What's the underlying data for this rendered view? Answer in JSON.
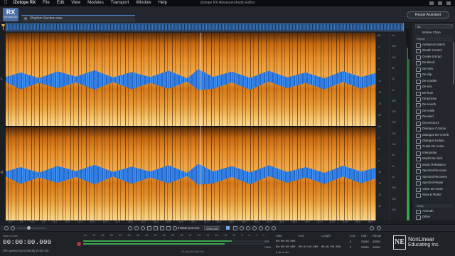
{
  "menubar": {
    "app_name": "iZotope RX",
    "items": [
      "File",
      "Edit",
      "View",
      "Modules",
      "Transport",
      "Window",
      "Help"
    ]
  },
  "window_title": "iZotope RX Advanced Audio Editor",
  "header": {
    "logo": "RX",
    "logo_sub": "ADVANCED",
    "file_tab": "Rhythm Section.wav",
    "repair_assistant": "Repair Assistant"
  },
  "panel": {
    "filter_value": "All",
    "module_chain": "Module Chain",
    "repair_header": "Repair",
    "modules": [
      "Ambience Match",
      "Breath Control",
      "Center Extract",
      "De-bleed",
      "De-click",
      "De-clip",
      "De-crackle",
      "De-ess",
      "De-hum",
      "De-plosive",
      "De-reverb",
      "De-rustle",
      "De-wind",
      "Deconstruct",
      "Dialogue Contour",
      "Dialogue De-reverb",
      "Dialogue Isolate",
      "Guitar De-noise",
      "Interpolate",
      "Mouth De-click",
      "Music Rebalance",
      "Spectral De-noise",
      "Spectral Recovery",
      "Spectral Repair",
      "Voice De-noise",
      "Wow & Flutter"
    ],
    "utility_header": "Utility",
    "utility_modules": [
      "Azimuth",
      "Dither"
    ]
  },
  "channel_labels": [
    "L",
    "R"
  ],
  "db_ticks": [
    "dB",
    "-3",
    "-6",
    "-9",
    "-12",
    "-15",
    "-20",
    "-30",
    "-inf",
    "-3",
    "-6",
    "-9",
    "-12",
    "-15",
    "-20",
    "-30"
  ],
  "hz_ticks": [
    "Hz",
    "20k",
    "10k",
    "5k",
    "2k",
    "1k",
    "500",
    "200",
    "100",
    "20k",
    "10k",
    "5k",
    "2k",
    "1k",
    "500",
    "200",
    "100"
  ],
  "ruler_ticks": [
    "0.0",
    "2.0",
    "4.0",
    "6.0",
    "8.0",
    "10.0",
    "12.0",
    "14.0",
    "16.0",
    "18.0",
    "20.0",
    "22.0",
    "24.0",
    "26.0",
    "28.0",
    "30.0",
    "32.0",
    "34.0",
    "36.0",
    "38.0",
    "40.0",
    "42.0",
    "44.0",
    "46.0",
    "48.0",
    "50.0",
    "52.0",
    "54.0",
    "56.0",
    "58.0"
  ],
  "toolbar": {
    "instant_process": "Instant process",
    "mode": "Attenuate"
  },
  "transport": {
    "label": "Sub.Lvl.sec",
    "time": "00:00:00.000",
    "status": "File opened successfully (0.00 ms)",
    "meter_scale": [
      "-inf",
      "-70",
      "-60",
      "-54",
      "-50",
      "-48",
      "-45",
      "-42",
      "-39",
      "-36",
      "-33",
      "-30",
      "-27",
      "-24",
      "-21",
      "-18",
      "-15",
      "-12",
      "-9",
      "-6",
      "-3",
      "0"
    ],
    "level_left": 0.82,
    "level_right": 0.78,
    "format": "24-bit | 48,000 Hz"
  },
  "selection": {
    "headers": [
      "Start",
      "End",
      "Length"
    ],
    "rows": [
      {
        "label": "Sel",
        "start": "00:00:00.000",
        "end": "",
        "length": ""
      },
      {
        "label": "View",
        "start": "00:00:00.000",
        "end": "00:01:00.000",
        "length": "00:01:00.000"
      }
    ],
    "format_label": "h:m:s.ms"
  },
  "range": {
    "headers": [
      "Low",
      "High",
      "Range"
    ],
    "rows": [
      {
        "low": "0",
        "high": "22050",
        "range": "22050"
      },
      {
        "low": "0",
        "high": "22050",
        "range": "22050"
      }
    ]
  },
  "branding": {
    "mark": "NE",
    "name": "NonLinear",
    "sub": "Educating Inc."
  },
  "colors": {
    "accent": "#4c8edb",
    "spectrogram_hot": "#f2a94a",
    "waveform": "#2f7be0"
  }
}
